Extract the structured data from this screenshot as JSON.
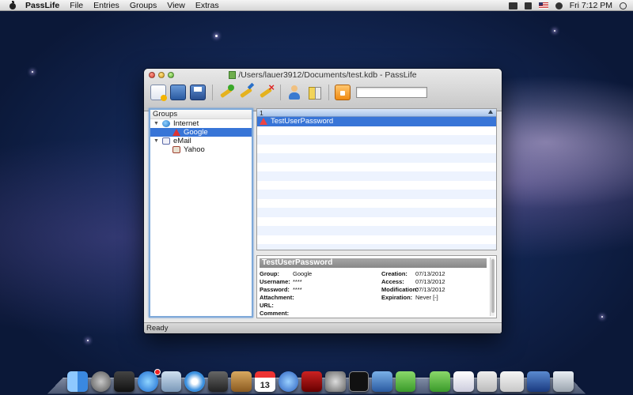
{
  "menubar": {
    "app_name": "PassLife",
    "items": [
      "File",
      "Entries",
      "Groups",
      "View",
      "Extras"
    ],
    "clock": "Fri 7:12 PM"
  },
  "window": {
    "title": "/Users/lauer3912/Documents/test.kdb - PassLife",
    "search_value": ""
  },
  "groups": {
    "header": "Groups",
    "tree": [
      {
        "label": "Internet",
        "level": 0,
        "icon": "globe-icon",
        "expanded": true,
        "selected": false
      },
      {
        "label": "Google",
        "level": 1,
        "icon": "warning-icon",
        "selected": true
      },
      {
        "label": "eMail",
        "level": 0,
        "icon": "mail-icon",
        "expanded": true,
        "selected": false
      },
      {
        "label": "Yahoo",
        "level": 1,
        "icon": "bookmark-icon",
        "selected": false
      }
    ]
  },
  "entries": {
    "column_header": "1",
    "rows": [
      {
        "title": "TestUserPassword",
        "selected": true
      }
    ]
  },
  "details": {
    "title": "TestUserPassword",
    "group_label": "Group:",
    "group_value": "Google",
    "username_label": "Username:",
    "username_value": "****",
    "password_label": "Password:",
    "password_value": "****",
    "attachment_label": "Attachment:",
    "url_label": "URL:",
    "comment_label": "Comment:",
    "creation_label": "Creation:",
    "creation_value": "07/13/2012",
    "access_label": "Access:",
    "access_value": "07/13/2012",
    "modification_label": "Modification:",
    "modification_value": "07/13/2012",
    "expiration_label": "Expiration:",
    "expiration_value": "Never [-]"
  },
  "status": {
    "text": "Ready"
  },
  "dock": {
    "calendar_day": "13"
  }
}
